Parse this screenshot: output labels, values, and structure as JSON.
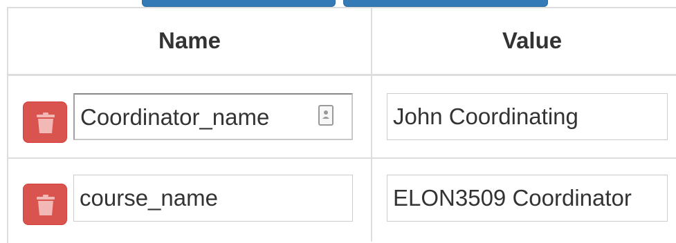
{
  "table": {
    "headers": {
      "name": "Name",
      "value": "Value"
    },
    "rows": [
      {
        "name": "Coordinator_name",
        "value": "John Coordinating"
      },
      {
        "name": "course_name",
        "value": "ELON3509 Coordinator"
      }
    ]
  },
  "icons": {
    "delete": "trash-icon",
    "autofill": "contact-card-icon"
  },
  "colors": {
    "danger": "#d9534f",
    "primary": "#337ab7",
    "border": "#dddddd"
  }
}
